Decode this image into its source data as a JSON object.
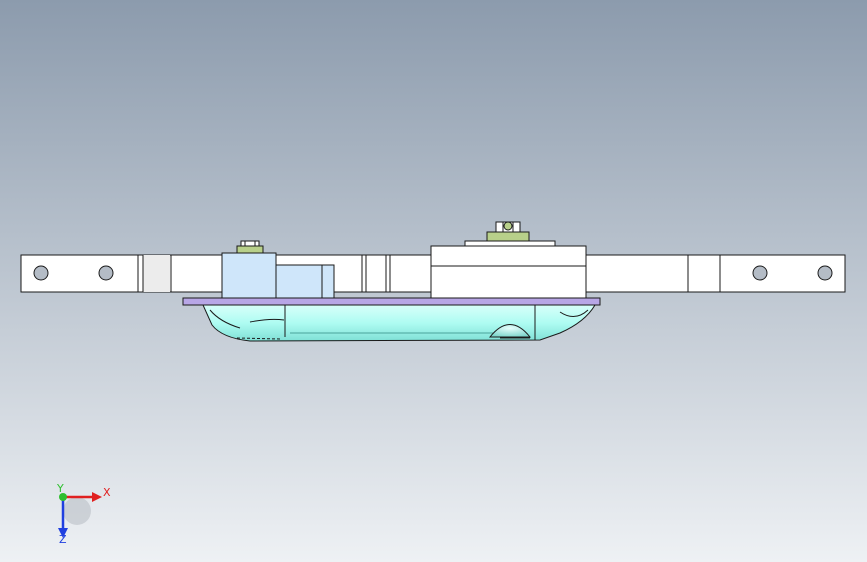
{
  "viewport": {
    "background_top": "#8c9bad",
    "background_bottom": "#eef1f4"
  },
  "model": {
    "plate_color": "#ffffff",
    "outline_color": "#1a1a1a",
    "pad_color": "#aefcf2",
    "block_color": "#cfe6fa",
    "strip_color": "#b8a6e6",
    "hardware_color": "#b8d08a"
  },
  "triad": {
    "x_label": "X",
    "y_label": "Y",
    "z_label": "Z",
    "x_color": "#e02020",
    "y_color": "#2fbf2f",
    "z_color": "#2040e0"
  }
}
